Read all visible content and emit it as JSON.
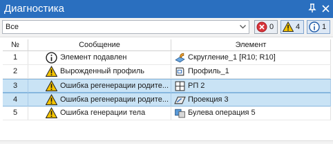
{
  "window": {
    "title": "Диагностика",
    "pin_icon": "pin-icon",
    "close_icon": "close-icon"
  },
  "toolbar": {
    "filter_value": "Все",
    "errors": {
      "icon": "error-icon",
      "count": "0"
    },
    "warnings": {
      "icon": "warning-icon",
      "count": "4"
    },
    "infos": {
      "icon": "info-icon",
      "count": "1"
    }
  },
  "table": {
    "headers": {
      "num": "№",
      "message": "Сообщение",
      "element": "Элемент"
    },
    "rows": [
      {
        "num": "1",
        "msg_icon": "info-icon",
        "message": "Элемент подавлен",
        "el_icon": "fillet-feature-icon",
        "element": "Скругление_1 [R10; R10]",
        "selected": false
      },
      {
        "num": "2",
        "msg_icon": "warning-icon",
        "message": "Вырожденный профиль",
        "el_icon": "profile-icon",
        "element": "Профиль_1",
        "selected": false
      },
      {
        "num": "3",
        "msg_icon": "warning-icon",
        "message": "Ошибка регенерации родите...",
        "el_icon": "plane-grid-icon",
        "element": "РП 2",
        "selected": true
      },
      {
        "num": "4",
        "msg_icon": "warning-icon",
        "message": "Ошибка регенерации родите...",
        "el_icon": "projection-icon",
        "element": "Проекция 3",
        "selected": true
      },
      {
        "num": "5",
        "msg_icon": "warning-icon",
        "message": "Ошибка генерации тела",
        "el_icon": "boolean-operation-icon",
        "element": "Булева операция 5",
        "selected": false
      }
    ]
  },
  "colors": {
    "titlebar": "#2a6fbf",
    "selection": "#c9e3f5",
    "warning": "#f5c400",
    "info": "#1e5aa8",
    "error": "#d9343a"
  }
}
